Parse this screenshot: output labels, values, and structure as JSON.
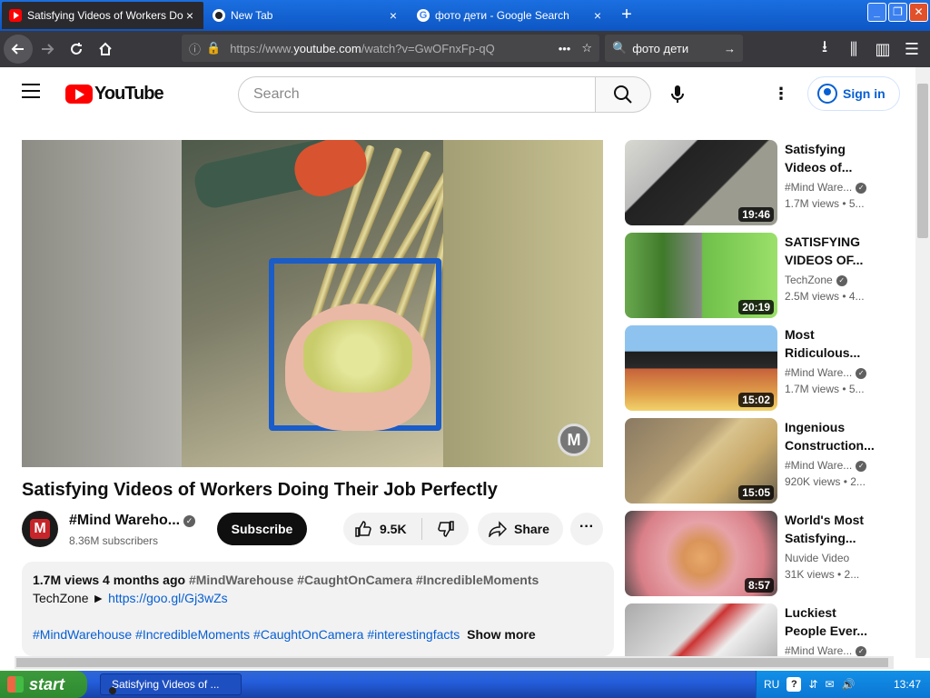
{
  "browser": {
    "tabs": [
      {
        "title": "Satisfying Videos of Workers Doing Th",
        "icon": "youtube-favicon",
        "active": true
      },
      {
        "title": "New Tab",
        "icon": "cat-favicon",
        "active": false
      },
      {
        "title": "фото дети - Google Search",
        "icon": "google-favicon",
        "active": false
      }
    ],
    "newtab_label": "+",
    "close_glyph": "×",
    "url_prefix": "https://www.",
    "url_domain": "youtube.com",
    "url_path": "/watch?v=GwOFnxFp-qQ",
    "search_query": "фото дети",
    "window_buttons": [
      "_",
      "❐",
      "✕"
    ]
  },
  "youtube": {
    "logo_text": "YouTube",
    "search_placeholder": "Search",
    "signin_label": "Sign in",
    "video": {
      "title": "Satisfying Videos of Workers Doing Their Job Perfectly",
      "watermark": "M",
      "channel_name": "#Mind Wareho...",
      "channel_avatar_letter": "M",
      "subscribers": "8.36M subscribers",
      "subscribe_label": "Subscribe",
      "likes": "9.5K",
      "share_label": "Share",
      "more_glyph": "···"
    },
    "description": {
      "views": "1.7M views",
      "age": "4 months ago",
      "tags": "#MindWarehouse #CaughtOnCamera #IncredibleMoments",
      "line2_prefix": "TechZone ►",
      "line2_link": "https://goo.gl/Gj3wZs",
      "hashtags": "#MindWarehouse #IncredibleMoments #CaughtOnCamera #interestingfacts",
      "show_more": "Show more"
    },
    "related": [
      {
        "title": "Satisfying Videos of...",
        "channel": "#Mind Ware...",
        "verified": true,
        "stats": "1.7M views • 5...",
        "duration": "19:46"
      },
      {
        "title": "SATISFYING VIDEOS OF...",
        "channel": "TechZone",
        "verified": true,
        "stats": "2.5M views • 4...",
        "duration": "20:19"
      },
      {
        "title": "Most Ridiculous...",
        "channel": "#Mind Ware...",
        "verified": true,
        "stats": "1.7M views • 5...",
        "duration": "15:02"
      },
      {
        "title": "Ingenious Construction...",
        "channel": "#Mind Ware...",
        "verified": true,
        "stats": "920K views • 2...",
        "duration": "15:05"
      },
      {
        "title": "World's Most Satisfying...",
        "channel": "Nuvide Video",
        "verified": false,
        "stats": "31K views • 2...",
        "duration": "8:57"
      },
      {
        "title": "Luckiest People Ever...",
        "channel": "#Mind Ware...",
        "verified": true,
        "stats": "",
        "duration": ""
      }
    ]
  },
  "taskbar": {
    "start_label": "start",
    "task_title": "Satisfying Videos of ...",
    "language": "RU",
    "help_glyph": "?",
    "time": "13:47"
  },
  "colors": {
    "firefox_tabbar": "#1b6fe0",
    "firefox_toolbar": "#38383d",
    "youtube_red": "#ff0000",
    "link_blue": "#065fd4",
    "xp_taskbar": "#245edb",
    "xp_start_green": "#3c9a3c"
  }
}
